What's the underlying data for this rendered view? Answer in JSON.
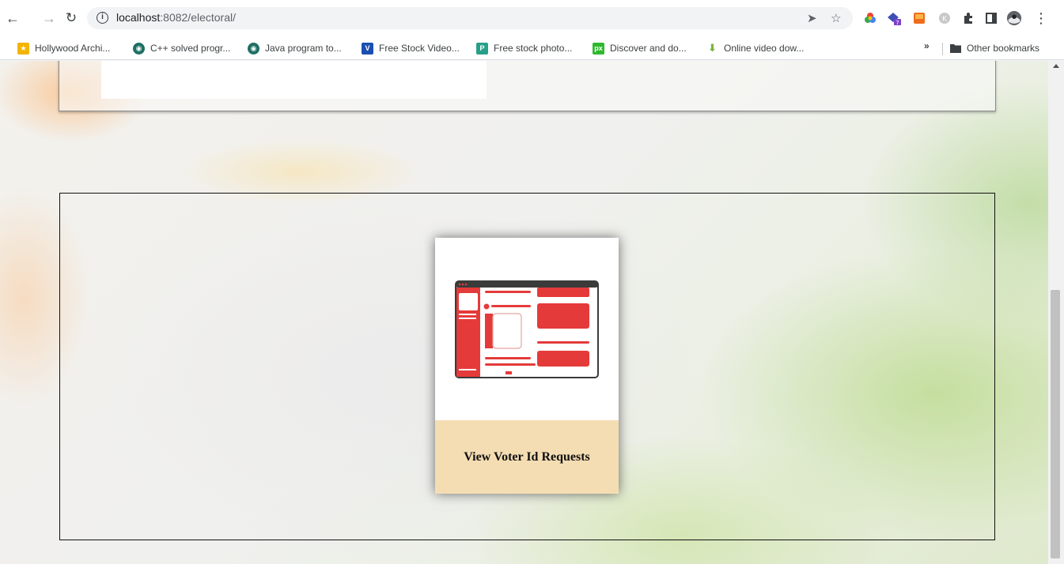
{
  "browser": {
    "url_host": "localhost",
    "url_rest": ":8082/electoral/",
    "bookmarks": [
      {
        "label": "Hollywood Archi...",
        "icon": "hollywood-favicon",
        "color": "#f4b400"
      },
      {
        "label": "C++ solved progr...",
        "icon": "cpp-favicon",
        "color": "#1f6f63"
      },
      {
        "label": "Java program to...",
        "icon": "java-favicon",
        "color": "#1f6f63"
      },
      {
        "label": "Free Stock Video...",
        "icon": "videvo-favicon",
        "color": "#1a4fb0"
      },
      {
        "label": "Free stock photo...",
        "icon": "pexels-photo-favicon",
        "color": "#27a08a"
      },
      {
        "label": "Discover and do...",
        "icon": "pixabay-favicon",
        "color": "#2eb82e"
      },
      {
        "label": "Online video dow...",
        "icon": "download-favicon",
        "color": "#8bc34a"
      }
    ],
    "bookmarks_more": "»",
    "other_bookmarks": "Other bookmarks"
  },
  "page": {
    "card": {
      "title": "View Voter Id Requests",
      "icon": "dashboard-window-illustration",
      "accent_color": "#e53a3a",
      "footer_color": "#f5ddb3"
    }
  }
}
